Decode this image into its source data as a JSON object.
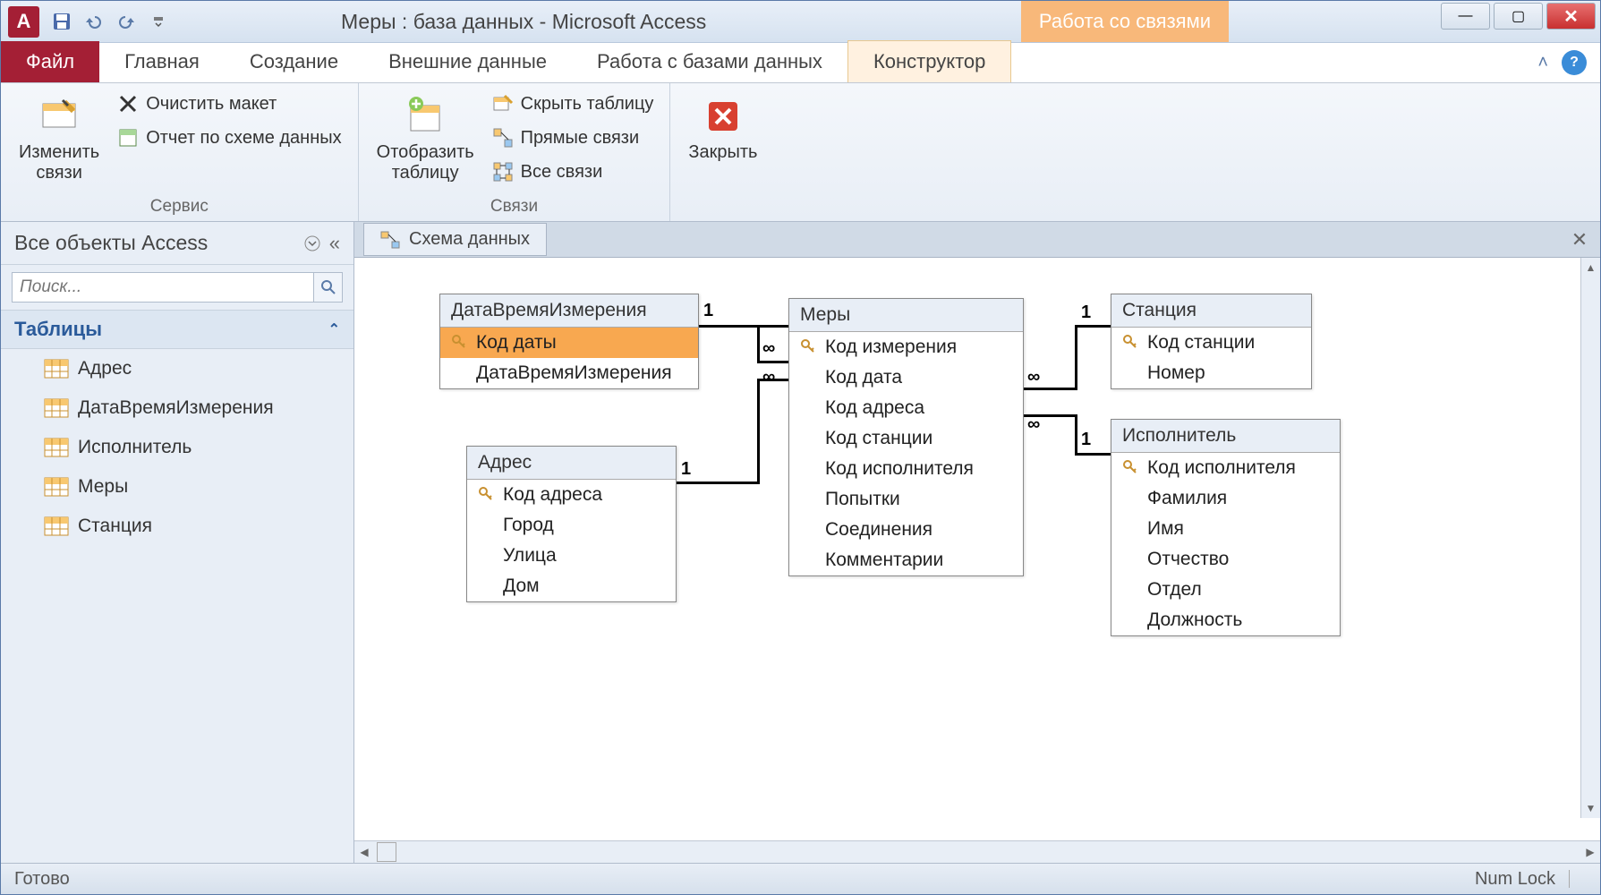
{
  "window": {
    "app_letter": "А",
    "title": "Меры : база данных  -  Microsoft Access",
    "contextual_title": "Работа со связями"
  },
  "win_controls": {
    "min": "—",
    "max": "▢",
    "close": "✕"
  },
  "ribbon": {
    "file": "Файл",
    "tabs": [
      "Главная",
      "Создание",
      "Внешние данные",
      "Работа с базами данных"
    ],
    "contextual_tab": "Конструктор",
    "collapse": "˄",
    "help": "?",
    "group1_label": "Сервис",
    "edit_rel": "Изменить связи",
    "clear_layout": "Очистить макет",
    "rel_report": "Отчет по схеме данных",
    "show_table": "Отобразить таблицу",
    "hide_table": "Скрыть таблицу",
    "direct_rel": "Прямые связи",
    "all_rel": "Все связи",
    "group2_label": "Связи",
    "close": "Закрыть"
  },
  "nav": {
    "header": "Все объекты Access",
    "collapse": "«",
    "search_placeholder": "Поиск...",
    "group": "Таблицы",
    "items": [
      "Адрес",
      "ДатаВремяИзмерения",
      "Исполнитель",
      "Меры",
      "Станция"
    ]
  },
  "doc": {
    "tab": "Схема данных",
    "close": "✕"
  },
  "entities": {
    "e1": {
      "title": "ДатаВремяИзмерения",
      "fields": [
        "Код даты",
        "ДатаВремяИзмерения"
      ],
      "pk": 0
    },
    "e2": {
      "title": "Адрес",
      "fields": [
        "Код адреса",
        "Город",
        "Улица",
        "Дом"
      ],
      "pk": 0
    },
    "e3": {
      "title": "Меры",
      "fields": [
        "Код измерения",
        "Код дата",
        "Код адреса",
        "Код станции",
        "Код исполнителя",
        "Попытки",
        "Соединения",
        "Комментарии"
      ],
      "pk": 0
    },
    "e4": {
      "title": "Станция",
      "fields": [
        "Код станции",
        "Номер"
      ],
      "pk": 0
    },
    "e5": {
      "title": "Исполнитель",
      "fields": [
        "Код исполнителя",
        "Фамилия",
        "Имя",
        "Отчество",
        "Отдел",
        "Должность"
      ],
      "pk": 0
    }
  },
  "rel": {
    "one": "1",
    "many": "∞"
  },
  "status": {
    "ready": "Готово",
    "numlock": "Num Lock"
  }
}
